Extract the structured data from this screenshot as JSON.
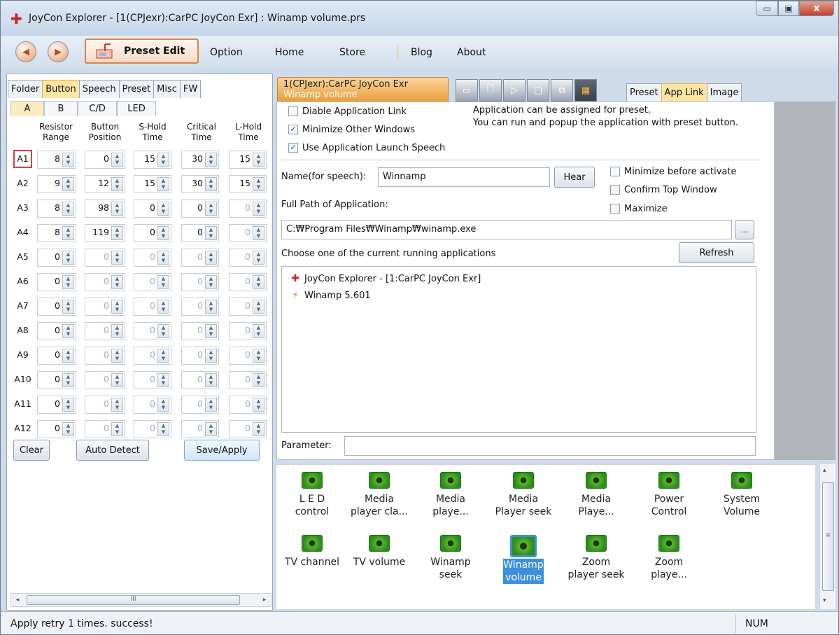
{
  "window": {
    "title": "JoyCon Explorer - [1(CPJexr):CarPC JoyCon Exr] : Winamp volume.prs",
    "app_icon": "joycon-star-icon",
    "minimize_glyph": "▭",
    "maximize_glyph": "▣",
    "close_glyph": "x"
  },
  "toolbar": {
    "back_glyph": "◀",
    "forward_glyph": "▶",
    "preset_edit_label": "Preset Edit",
    "menus": [
      "Option",
      "Home",
      "Store",
      "Blog",
      "About"
    ]
  },
  "left_tabs": [
    "Folder",
    "Button",
    "Speech",
    "Preset",
    "Misc",
    "FW"
  ],
  "left_active_tab": "Button",
  "sub_tabs": [
    "A",
    "B",
    "C/D",
    "LED"
  ],
  "table": {
    "headers": [
      [
        "Resistor",
        "Range"
      ],
      [
        "Button",
        "Position"
      ],
      [
        "S-Hold",
        "Time"
      ],
      [
        "Critical",
        "Time"
      ],
      [
        "L-Hold",
        "Time"
      ]
    ],
    "rows": [
      {
        "label": "A1",
        "values": [
          "8",
          "0",
          "15",
          "30",
          "15"
        ]
      },
      {
        "label": "A2",
        "values": [
          "9",
          "12",
          "15",
          "30",
          "15"
        ]
      },
      {
        "label": "A3",
        "values": [
          "8",
          "98",
          "0",
          "0",
          "0"
        ]
      },
      {
        "label": "A4",
        "values": [
          "8",
          "119",
          "0",
          "0",
          "0"
        ]
      },
      {
        "label": "A5",
        "values": [
          "0",
          "0",
          "0",
          "0",
          "0"
        ]
      },
      {
        "label": "A6",
        "values": [
          "0",
          "0",
          "0",
          "0",
          "0"
        ]
      },
      {
        "label": "A7",
        "values": [
          "0",
          "0",
          "0",
          "0",
          "0"
        ]
      },
      {
        "label": "A8",
        "values": [
          "0",
          "0",
          "0",
          "0",
          "0"
        ]
      },
      {
        "label": "A9",
        "values": [
          "0",
          "0",
          "0",
          "0",
          "0"
        ]
      },
      {
        "label": "A10",
        "values": [
          "0",
          "0",
          "0",
          "0",
          "0"
        ]
      },
      {
        "label": "A11",
        "values": [
          "0",
          "0",
          "0",
          "0",
          "0"
        ]
      },
      {
        "label": "A12",
        "values": [
          "0",
          "0",
          "0",
          "0",
          "0"
        ]
      }
    ]
  },
  "left_buttons": {
    "clear": "Clear",
    "auto_detect": "Auto Detect",
    "save_apply": "Save/Apply"
  },
  "hscroll": {
    "left": "◂",
    "grip": "III",
    "right": "▸"
  },
  "doc_tab": {
    "line1": "1(CPJexr):CarPC JoyCon Exr",
    "line2": "Winamp volume"
  },
  "doc_tools": [
    "▭",
    "🗋",
    "▷",
    "□",
    "⧉",
    "▦"
  ],
  "right_tabs": [
    "Preset",
    "App Link",
    "Image"
  ],
  "right_active_tab": "App Link",
  "app_link": {
    "disable_link": "Diable Application Link",
    "minimize_other": "Minimize Other Windows",
    "use_launch_speech": "Use Application Launch Speech",
    "check_glyph": "✓",
    "info_line1": "Application can be assigned for preset.",
    "info_line2": "You can run and popup the application with preset button.",
    "name_label": "Name(for speech):",
    "name_value": "Winnamp",
    "hear_button": "Hear",
    "minimize_before": "Minimize before activate",
    "confirm_top": "Confirm Top Window",
    "maximize": "Maximize",
    "path_label": "Full Path of Application:",
    "path_value": "C:₩Program Files₩Winamp₩winamp.exe",
    "browse_button": "...",
    "running_label": "Choose one of the current running applications",
    "refresh_button": "Refresh",
    "running_apps": [
      "JoyCon Explorer - [1:CarPC JoyCon Exr]",
      "Winamp 5.601"
    ],
    "parameter_label": "Parameter:",
    "parameter_value": ""
  },
  "presets": [
    {
      "line1": "L E D",
      "line2": "control"
    },
    {
      "line1": "Media",
      "line2": "player cla..."
    },
    {
      "line1": "Media",
      "line2": "playe..."
    },
    {
      "line1": "Media",
      "line2": "Player seek"
    },
    {
      "line1": "Media",
      "line2": "Playe..."
    },
    {
      "line1": "Power",
      "line2": "Control"
    },
    {
      "line1": "System",
      "line2": "Volume"
    },
    {
      "line1": "TV channel",
      "line2": ""
    },
    {
      "line1": "TV volume",
      "line2": ""
    },
    {
      "line1": "Winamp",
      "line2": "seek"
    },
    {
      "line1": "Winamp",
      "line2": "volume"
    },
    {
      "line1": "Zoom",
      "line2": "player seek"
    },
    {
      "line1": "Zoom",
      "line2": "playe..."
    }
  ],
  "selected_preset": "Winamp volume",
  "vscroll": {
    "up": "▴",
    "grip": "≡",
    "down": "▾"
  },
  "status": {
    "message": "Apply retry  1 times. success!",
    "num": "NUM"
  },
  "colors": {
    "accent_orange": "#e99a35",
    "selection_blue": "#3d8fe0",
    "tab_active": "#fde5a4"
  }
}
